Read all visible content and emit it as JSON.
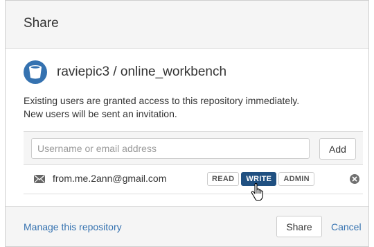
{
  "dialog": {
    "title": "Share"
  },
  "repository": {
    "icon": "repository-icon",
    "title": "raviepic3 / online_workbench"
  },
  "description": {
    "line1": "Existing users are granted access to this repository immediately.",
    "line2": "New users will be sent an invitation."
  },
  "user_input": {
    "value": "",
    "placeholder": "Username or email address"
  },
  "add_button": {
    "label": "Add"
  },
  "users": [
    {
      "icon": "envelope-icon",
      "email": "from.me.2ann@gmail.com",
      "permissions": [
        "READ",
        "WRITE",
        "ADMIN"
      ],
      "selected_permission": "WRITE",
      "remove_icon": "remove-circle-icon"
    }
  ],
  "footer": {
    "manage_link": "Manage this repository",
    "share_button": "Share",
    "cancel_link": "Cancel"
  },
  "colors": {
    "accent": "#205081",
    "link": "#3572b0",
    "header_bg": "#f5f5f5",
    "text": "#333333"
  }
}
